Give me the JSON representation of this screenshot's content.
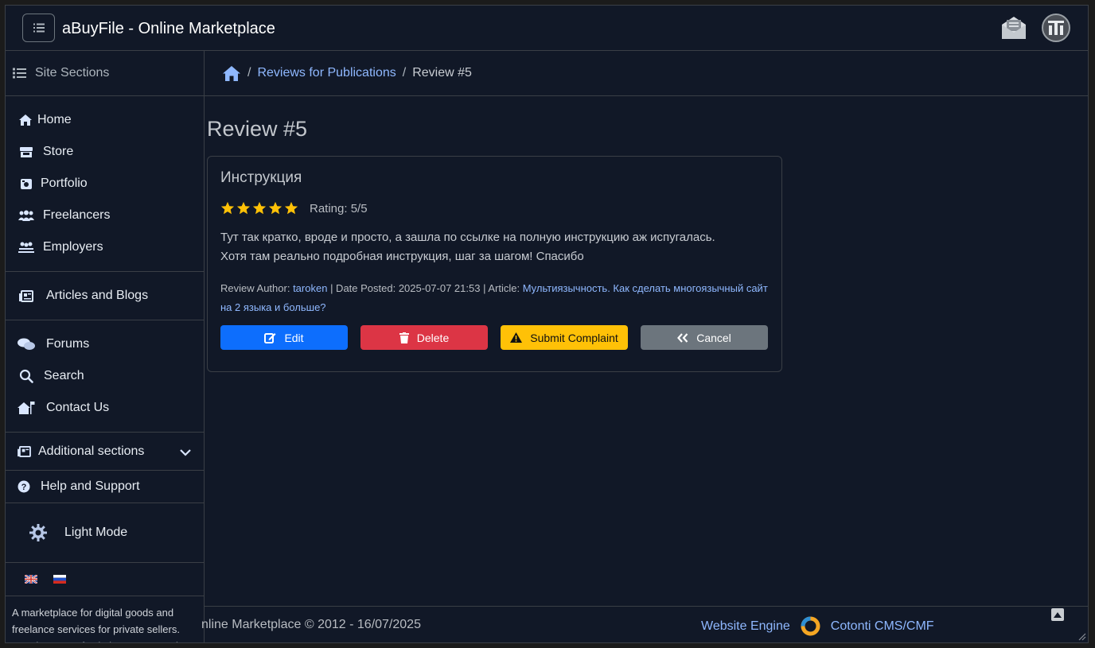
{
  "header": {
    "title": "aBuyFile - Online Marketplace"
  },
  "sidebar": {
    "heading": "Site Sections",
    "groups": [
      [
        {
          "label": "Home",
          "icon": "home-icon"
        },
        {
          "label": "Store",
          "icon": "store-icon"
        },
        {
          "label": "Portfolio",
          "icon": "camera-icon"
        },
        {
          "label": "Freelancers",
          "icon": "users-icon"
        },
        {
          "label": "Employers",
          "icon": "employers-icon"
        }
      ],
      [
        {
          "label": "Articles and Blogs",
          "icon": "newspaper-icon"
        }
      ],
      [
        {
          "label": "Forums",
          "icon": "comments-icon"
        },
        {
          "label": "Search",
          "icon": "search-icon"
        },
        {
          "label": "Contact Us",
          "icon": "house-flag-icon"
        }
      ]
    ],
    "additional": "Additional sections",
    "help": "Help and Support",
    "theme": "Light Mode",
    "about": "A marketplace for digital goods and freelance services for private sellers. Development of solutions on Cotonti"
  },
  "breadcrumb": {
    "items": [
      "Reviews for Publications",
      "Review #5"
    ]
  },
  "page": {
    "title": "Review #5"
  },
  "review": {
    "title": "Инструкция",
    "rating_value": 5,
    "rating_max": 5,
    "rating_label": "Rating: 5/5",
    "text_line1": "Тут так кратко, вроде и просто, а зашла по ссылке на полную инструкцию аж испугалась.",
    "text_line2": "Хотя там реально подробная инструкция, шаг за шагом! Спасибо",
    "author_label": "Review Author:",
    "author": "taroken",
    "date_label": "| Date Posted: 2025-07-07 21:53 | Article:",
    "article": "Мультиязычность. Как сделать многоязычный сайт на 2 языка и больше?"
  },
  "actions": {
    "edit": "Edit",
    "delete": "Delete",
    "complaint": "Submit Complaint",
    "cancel": "Cancel"
  },
  "footer": {
    "copyright": "nline Marketplace © 2012 - 16/07/2025",
    "engine_label": "Website Engine",
    "engine_name": "Cotonti CMS/CMF"
  },
  "colors": {
    "accent": "#0d6efd",
    "danger": "#dc3545",
    "warning": "#ffc107",
    "secondary": "#6c757d",
    "star": "#ffc107",
    "link": "#8fb8ff",
    "background": "#111827"
  }
}
